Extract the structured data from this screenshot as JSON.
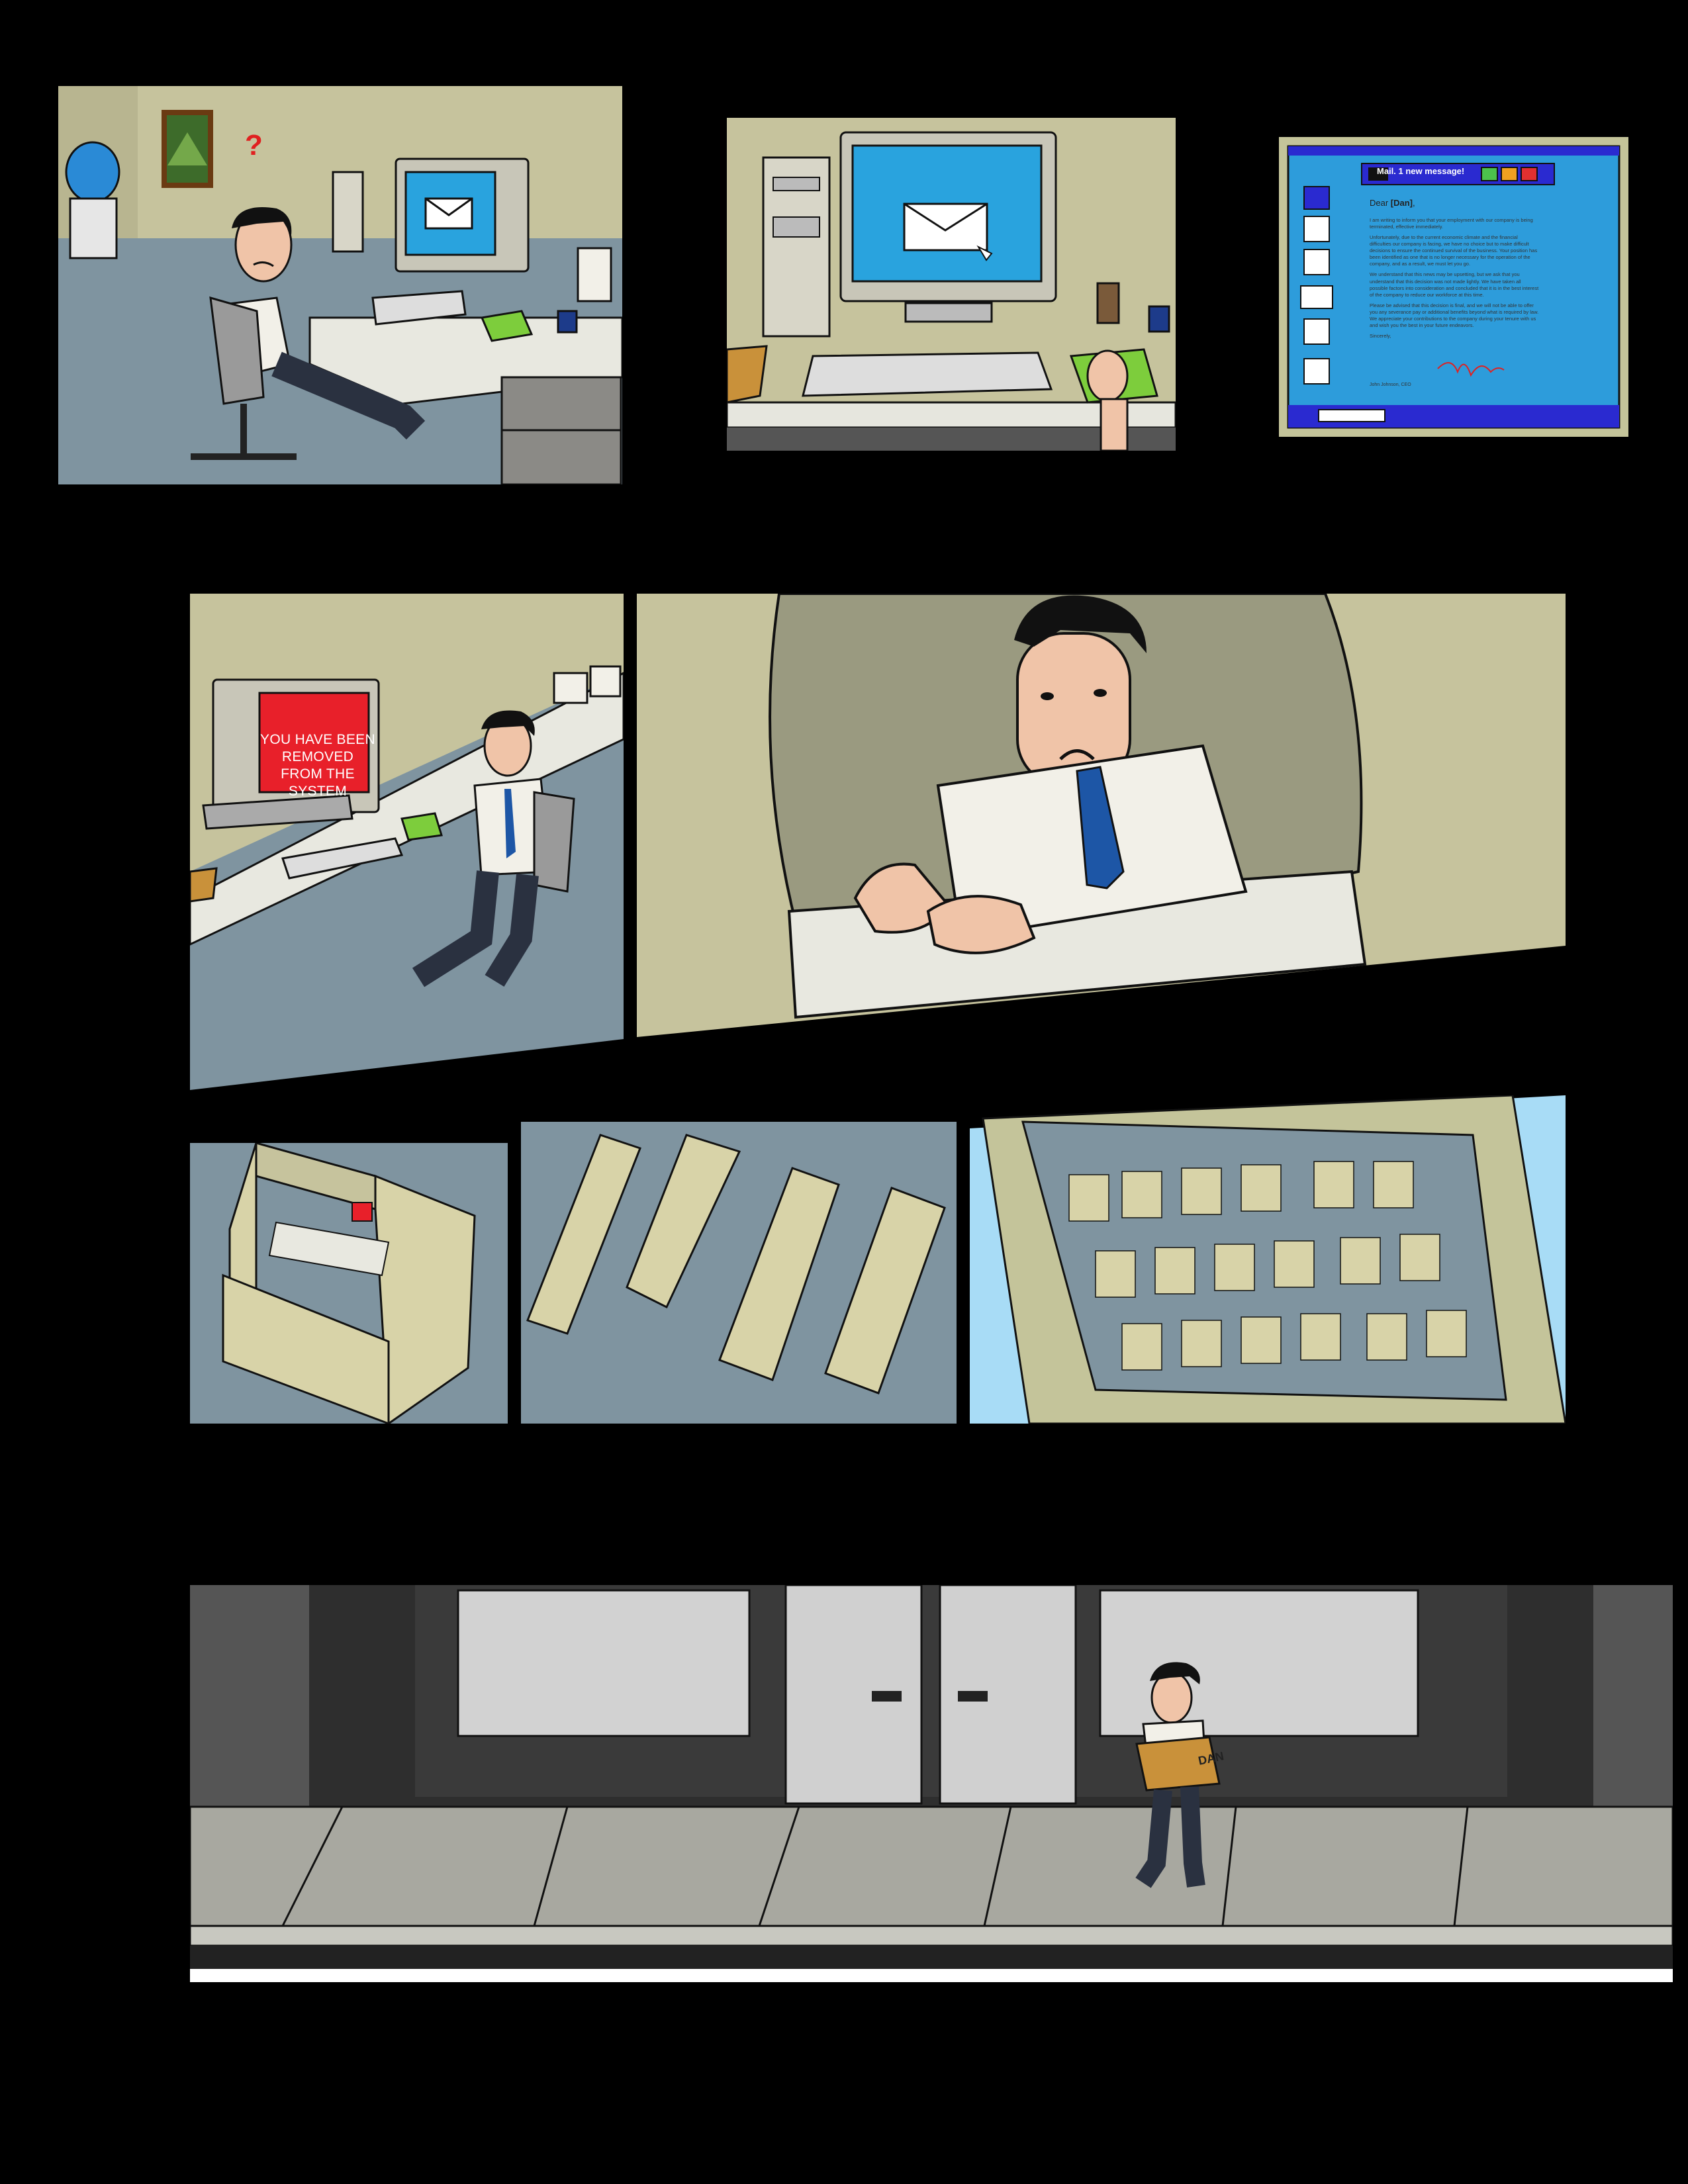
{
  "comic": {
    "panel1": {
      "question_mark": "?"
    },
    "mail_window": {
      "title": "Mail. 1 new message!",
      "greeting_prefix": "Dear ",
      "greeting_name": "[Dan]",
      "greeting_suffix": ",",
      "paragraphs": [
        "I am writing to inform you that your employment with our company is being terminated, effective immediately.",
        "Unfortunately, due to the current economic climate and the financial difficulties our company is facing, we have no choice but to make difficult decisions to ensure the continued survival of the business. Your position has been identified as one that is no longer necessary for the operation of the company, and as a result, we must let you go.",
        "We understand that this news may be upsetting, but we ask that you understand that this decision was not made lightly. We have taken all possible factors into consideration and concluded that it is in the best interest of the company to reduce our workforce at this time.",
        "Please be advised that this decision is final, and we will not be able to offer you any severance pay or additional benefits beyond what is required by law. We appreciate your contributions to the company during your tenure with us and wish you the best in your future endeavors."
      ],
      "closing": "Sincerely,",
      "signer": "John Johnson, CEO",
      "sidebar_letters": [
        "T",
        "P",
        "$",
        "W",
        "S"
      ],
      "colors": {
        "frame": "#c4c49a",
        "window": "#2a2ad0",
        "accent": "#2d9cdb"
      }
    },
    "system_screen": {
      "text": "YOU HAVE BEEN REMOVED FROM THE SYSTEM",
      "color": "#e8202a"
    },
    "box_label": "DAN"
  }
}
